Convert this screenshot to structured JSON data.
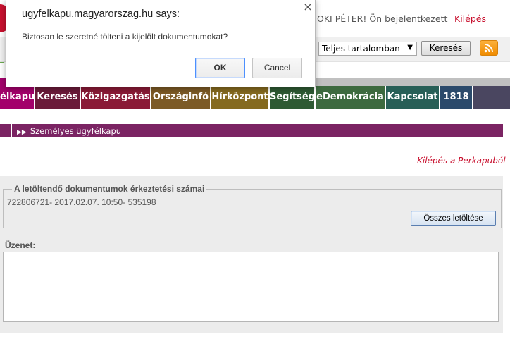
{
  "header": {
    "user_text": "OKI PÉTER! Ön bejelentkezett",
    "logout": "Kilépés"
  },
  "search": {
    "scope_selected": "Teljes tartalomban",
    "button": "Keresés"
  },
  "nav": {
    "items": [
      {
        "label": "élkapu",
        "color": "#a3006b",
        "width": 50
      },
      {
        "label": "Keresés",
        "color": "#6b1b3a",
        "width": 65
      },
      {
        "label": "Közigazgatás",
        "color": "#8a1a36",
        "width": 100
      },
      {
        "label": "Országinfó",
        "color": "#7c5a25",
        "width": 85
      },
      {
        "label": "Hírközpont",
        "color": "#856a1f",
        "width": 83
      },
      {
        "label": "Segítség",
        "color": "#2e5a33",
        "width": 65
      },
      {
        "label": "eDemokrácia",
        "color": "#3d6a3f",
        "width": 100
      },
      {
        "label": "Kapcsolat",
        "color": "#285f57",
        "width": 77
      },
      {
        "label": "1818",
        "color": "#2b4a6b",
        "width": 47
      }
    ]
  },
  "breadcrumb": {
    "current": "Személyes ügyfélkapu"
  },
  "exit_perka": "Kilépés a Perkapuból",
  "documents": {
    "legend": "A letöltendő dokumentumok érkeztetési számai",
    "line": "722806721- 2017.02.07. 10:50- 535198",
    "download_all": "Összes letöltése"
  },
  "message": {
    "label": "Üzenet:",
    "value": ""
  },
  "dialog": {
    "title": "ugyfelkapu.magyarorszag.hu says:",
    "message": "Biztosan le szeretné tölteni a kijelölt dokumentumokat?",
    "ok": "OK",
    "cancel": "Cancel"
  },
  "colors": {
    "accent_red": "#c8102e",
    "breadcrumb": "#7b2463",
    "rss": "#f08c00"
  }
}
